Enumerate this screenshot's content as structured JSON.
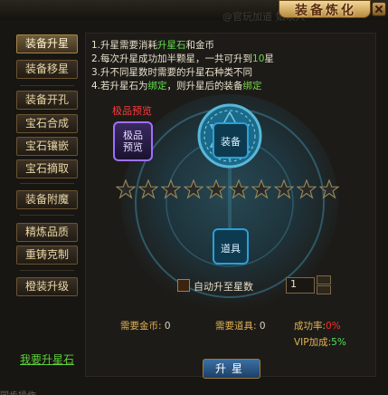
{
  "window": {
    "title": "装备炼化",
    "watermark": "@官玩加道 如以人"
  },
  "sidebar": {
    "items": [
      {
        "label": "装备升星",
        "active": true
      },
      {
        "label": "装备移星",
        "active": false
      },
      {
        "label": "装备开孔",
        "active": false
      },
      {
        "label": "宝石合成",
        "active": false
      },
      {
        "label": "宝石镶嵌",
        "active": false
      },
      {
        "label": "宝石摘取",
        "active": false
      },
      {
        "label": "装备附魔",
        "active": false
      },
      {
        "label": "精炼品质",
        "active": false
      },
      {
        "label": "重铸克制",
        "active": false
      },
      {
        "label": "橙装升级",
        "active": false
      }
    ],
    "my_stone_link": "我要升星石"
  },
  "notes": [
    {
      "pre": "1.升星需要消耗",
      "hl": "升星石",
      "post": "和金币"
    },
    {
      "pre": "2.每次升星成功加半颗星，一共可升到",
      "hl": "10",
      "post": "星"
    },
    {
      "pre": "3.升不同星数时需要的升星石种类不同",
      "hl": "",
      "post": ""
    },
    {
      "pre": "4.若升星石为",
      "hl": "绑定",
      "post": "，则升星后的装备",
      "hl2": "绑定"
    }
  ],
  "upgrade": {
    "quality_label": "极品预览",
    "quality_box_text": [
      "极品",
      "预览"
    ],
    "equip_slot_label": "装备",
    "item_slot_label": "道具",
    "stars_total": 10,
    "stars_filled": 0,
    "auto_label": "自动升至星数",
    "auto_checked": false,
    "auto_value": "1"
  },
  "costs": {
    "gold_label": "需要金币:",
    "gold_value": "0",
    "item_label": "需要道具:",
    "item_value": "0",
    "rate_label": "成功率:",
    "rate_value": "0%",
    "vip_label": "VIP加成:",
    "vip_value": "5%"
  },
  "action": {
    "star_up": "升星"
  },
  "footer": {
    "text": "同步操作"
  },
  "colors": {
    "gold": "#e0b257",
    "green": "#5fe04a",
    "red": "#ff2a2a",
    "teal": "#2aa0d8"
  }
}
